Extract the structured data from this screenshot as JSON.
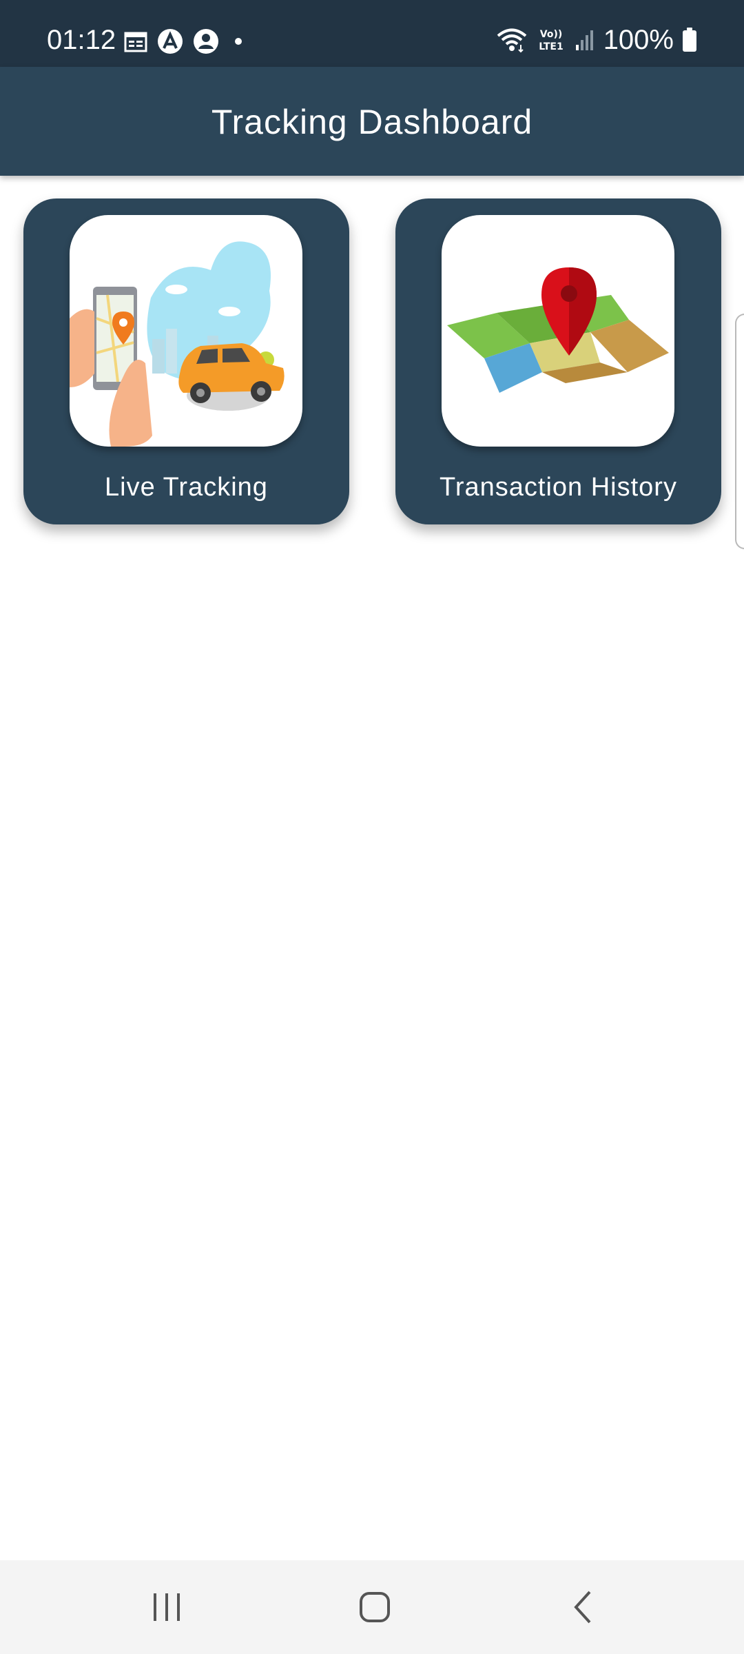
{
  "status_bar": {
    "time": "01:12",
    "left_icons": [
      "calendar-icon",
      "app-a-icon",
      "account-icon",
      "dot-icon"
    ],
    "network_label": "Vo)) LTE1",
    "battery_percent": "100%"
  },
  "app_bar": {
    "title": "Tracking Dashboard"
  },
  "cards": [
    {
      "label": "Live Tracking",
      "image": "live-tracking-illustration"
    },
    {
      "label": "Transaction History",
      "image": "map-pin-illustration"
    }
  ],
  "nav_bar": {
    "buttons": [
      "recents-icon",
      "home-icon",
      "back-icon"
    ]
  },
  "colors": {
    "status_bar": "#223444",
    "app_bar": "#2c4659",
    "card": "#2c4659",
    "nav_bar": "#f4f4f4"
  }
}
